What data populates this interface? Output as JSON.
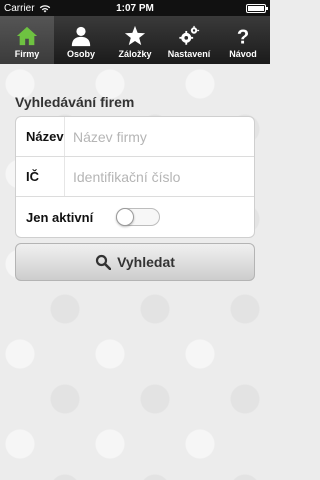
{
  "status_bar": {
    "carrier": "Carrier",
    "time": "1:07 PM",
    "battery_level": 1.0
  },
  "tabs": [
    {
      "label": "Firmy",
      "icon": "home-icon",
      "active": true
    },
    {
      "label": "Osoby",
      "icon": "person-icon",
      "active": false
    },
    {
      "label": "Záložky",
      "icon": "star-icon",
      "active": false
    },
    {
      "label": "Nastavení",
      "icon": "gears-icon",
      "active": false
    },
    {
      "label": "Návod",
      "icon": "question-icon",
      "active": false
    }
  ],
  "colors": {
    "active_icon": "#6ec241"
  },
  "form": {
    "title": "Vyhledávání firem",
    "name": {
      "label": "Název",
      "placeholder": "Název firmy",
      "value": ""
    },
    "ic": {
      "label": "IČ",
      "placeholder": "Identifikační číslo",
      "value": ""
    },
    "active_only": {
      "label": "Jen aktivní",
      "on": false
    }
  },
  "search_button": {
    "label": "Vyhledat",
    "icon": "search-icon"
  }
}
